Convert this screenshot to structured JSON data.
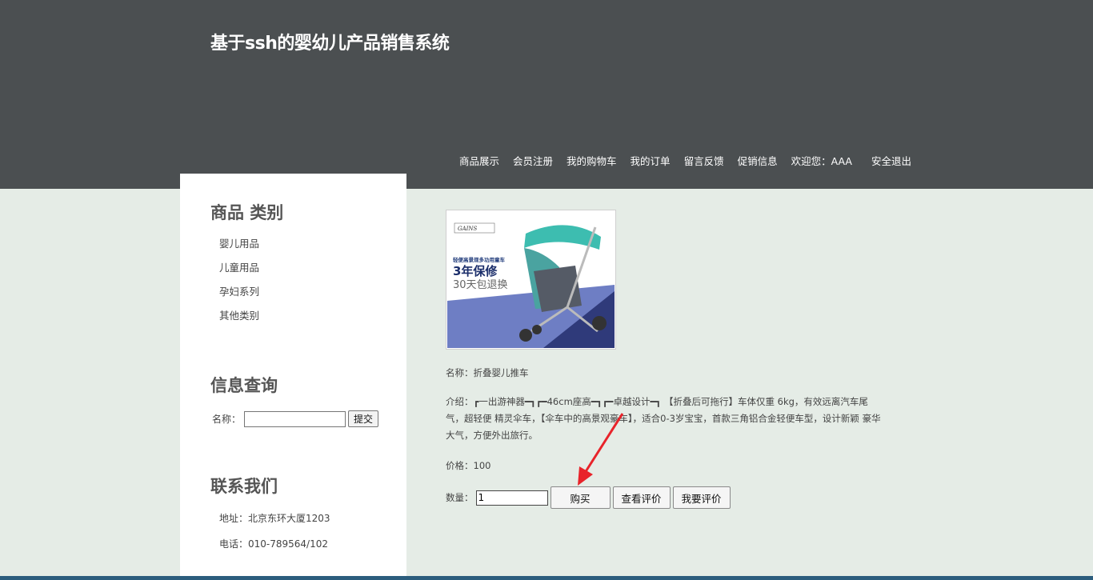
{
  "header": {
    "site_title": "基于ssh的婴幼儿产品销售系统",
    "nav": [
      "商品展示",
      "会员注册",
      "我的购物车",
      "我的订单",
      "留言反馈",
      "促销信息"
    ],
    "welcome": "欢迎您：AAA",
    "logout": "安全退出"
  },
  "sidebar": {
    "category_title": "商品 类别",
    "categories": [
      "婴儿用品",
      "儿童用品",
      "孕妇系列",
      "其他类别"
    ],
    "search_title": "信息查询",
    "search_label": "名称：",
    "search_value": "",
    "search_button": "提交",
    "contact_title": "联系我们",
    "address": "地址：北京东环大厦1203",
    "phone": "电话：010-789564/102"
  },
  "product": {
    "image_brand": "GAINS",
    "image_tagline": "轻便高景观多功用童车",
    "image_warranty": "3年保修",
    "image_return": "30天包退换",
    "name": "名称：折叠婴儿推车",
    "description": "介绍：┏一出游神器━┓┏━46cm座高━┓┏━卓越设计━┓ 【折叠后可拖行】车体仅重 6kg，有效远离汽车尾气，超轻便 精灵伞车，【伞车中的高景观豪车】，适合0-3岁宝宝，首款三角铝合金轻便车型，设计新颖 豪华大气，方便外出旅行。",
    "price": "价格：100",
    "quantity_label": "数量：",
    "quantity_value": "1",
    "buy_button": "购买",
    "view_reviews_button": "查看评价",
    "write_review_button": "我要评价"
  },
  "colors": {
    "header_bg": "#4b4f51",
    "page_bg": "#e5ece6",
    "annotation_arrow": "#e8232a"
  }
}
